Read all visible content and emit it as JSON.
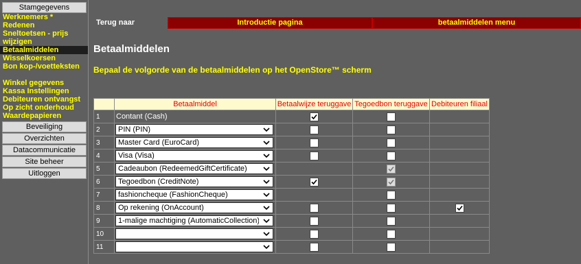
{
  "sidebar": {
    "stamgegevens": "Stamgegevens",
    "items": [
      {
        "label": "Werknemers *",
        "active": false
      },
      {
        "label": "Redenen",
        "active": false
      },
      {
        "label": "Sneltoetsen - prijs wijzigen",
        "active": false
      },
      {
        "label": "Betaalmiddelen",
        "active": true
      },
      {
        "label": "Wisselkoersen",
        "active": false
      },
      {
        "label": "Bon kop-/voetteksten",
        "active": false
      }
    ],
    "items2": [
      {
        "label": "Winkel gegevens"
      },
      {
        "label": "Kassa Instellingen"
      },
      {
        "label": "Debiteuren ontvangst"
      },
      {
        "label": "Op zicht onderhoud"
      },
      {
        "label": "Waardepapieren"
      }
    ],
    "bottom": [
      "Beveiliging",
      "Overzichten",
      "Datacommunicatie",
      "Site beheer",
      "Uitloggen"
    ]
  },
  "nav": {
    "label": "Terug naar",
    "buttons": [
      "Introductie pagina",
      "betaalmiddelen menu"
    ]
  },
  "page_title": "Betaalmiddelen",
  "subtitle": "Bepaal de volgorde van de betaalmiddelen op het OpenStore™ scherm",
  "table": {
    "headers": [
      "Betaalmiddel",
      "Betaalwijze teruggave",
      "Tegoedbon teruggave",
      "Debiteuren filiaal"
    ],
    "rows": [
      {
        "num": "1",
        "name": "Contant (Cash)",
        "select": false,
        "a": "checked",
        "b": "unchecked",
        "c": "none"
      },
      {
        "num": "2",
        "name": "PIN (PIN)",
        "select": true,
        "a": "unchecked",
        "b": "unchecked",
        "c": "none"
      },
      {
        "num": "3",
        "name": "Master Card (EuroCard)",
        "select": true,
        "a": "unchecked",
        "b": "unchecked",
        "c": "none"
      },
      {
        "num": "4",
        "name": "Visa (Visa)",
        "select": true,
        "a": "unchecked",
        "b": "unchecked",
        "c": "none"
      },
      {
        "num": "5",
        "name": "Cadeaubon (RedeemedGiftCertificate)",
        "select": true,
        "a": "none",
        "b": "checked-disabled",
        "c": "none"
      },
      {
        "num": "6",
        "name": "Tegoedbon (CreditNote)",
        "select": true,
        "a": "checked",
        "b": "checked-disabled",
        "c": "none"
      },
      {
        "num": "7",
        "name": "fashioncheque (FashionCheque)",
        "select": true,
        "a": "none",
        "b": "unchecked",
        "c": "none"
      },
      {
        "num": "8",
        "name": "Op rekening (OnAccount)",
        "select": true,
        "a": "unchecked",
        "b": "unchecked",
        "c": "checked"
      },
      {
        "num": "9",
        "name": "1-malige machtiging (AutomaticCollection)",
        "select": true,
        "a": "unchecked",
        "b": "unchecked",
        "c": "none"
      },
      {
        "num": "10",
        "name": "",
        "select": true,
        "a": "unchecked",
        "b": "unchecked",
        "c": "none"
      },
      {
        "num": "11",
        "name": "",
        "select": true,
        "a": "unchecked",
        "b": "unchecked",
        "c": "none"
      }
    ]
  }
}
